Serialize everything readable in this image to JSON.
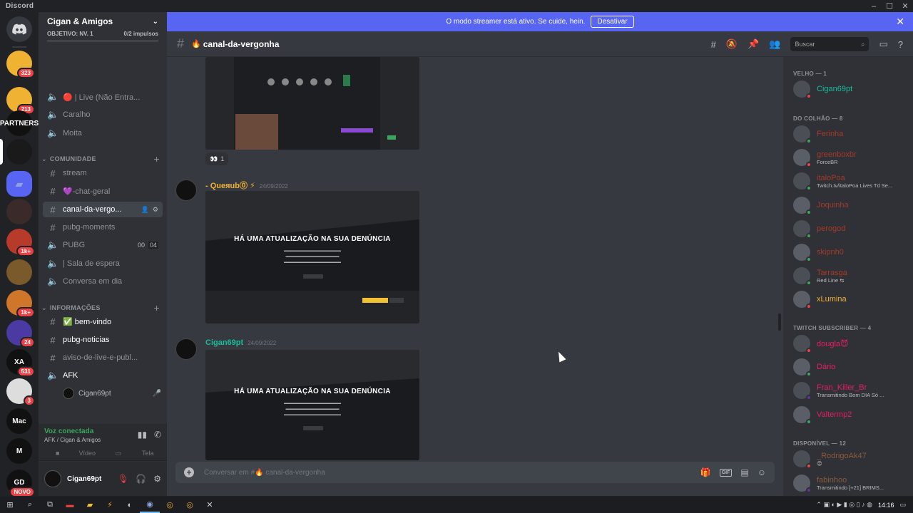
{
  "window": {
    "app_name": "Discord",
    "min": "–",
    "max": "☐",
    "close": "✕"
  },
  "rail": {
    "servers": [
      {
        "name": "server-1",
        "badge": "323",
        "color": "#f0b232",
        "label": ""
      },
      {
        "name": "server-2",
        "badge": "213",
        "color": "#f0b232",
        "label": ""
      },
      {
        "name": "server-partners",
        "badge": "",
        "color": "#111111",
        "label": "PARTNERS"
      },
      {
        "name": "server-cigan",
        "badge": "",
        "color": "#1a1a1a",
        "label": ""
      },
      {
        "name": "folder",
        "badge": "",
        "color": "#5865f2",
        "label": ""
      },
      {
        "name": "server-6",
        "badge": "",
        "color": "#3a2a2a",
        "label": ""
      },
      {
        "name": "server-7",
        "badge": "1k+",
        "color": "#b83a2a",
        "label": ""
      },
      {
        "name": "server-8",
        "badge": "",
        "color": "#7a5a2a",
        "label": ""
      },
      {
        "name": "server-9",
        "badge": "1k+",
        "color": "#d0762a",
        "label": ""
      },
      {
        "name": "server-10",
        "badge": "24",
        "color": "#4a3aa2",
        "label": ""
      },
      {
        "name": "server-xa",
        "badge": "531",
        "color": "#111111",
        "label": "XA"
      },
      {
        "name": "server-12",
        "badge": "3",
        "color": "#dddddd",
        "label": ""
      },
      {
        "name": "server-mac",
        "badge": "",
        "color": "#111111",
        "label": "Mac"
      },
      {
        "name": "server-m",
        "badge": "",
        "color": "#111111",
        "label": "M"
      },
      {
        "name": "server-gd",
        "badge": "NOVO",
        "color": "#111111",
        "label": "GD"
      }
    ]
  },
  "sidebar": {
    "server_name": "Cigan & Amigos",
    "boost": {
      "level": "OBJETIVO: NV. 1",
      "count": "0/2 impulsos"
    },
    "channels_top": [
      {
        "icon": "🔊",
        "label": "🔴 | Live (Não Entra...",
        "type": "voice"
      },
      {
        "icon": "🔊",
        "label": "Caralho",
        "type": "voice"
      },
      {
        "icon": "🔊",
        "label": "Moita",
        "type": "voice"
      }
    ],
    "cat_comunidade": "COMUNIDADE",
    "comunidade": [
      {
        "label": "stream"
      },
      {
        "label": "💜-chat-geral"
      },
      {
        "label": "canal-da-vergo..."
      },
      {
        "label": "pubg-moments"
      },
      {
        "label": "PUBG",
        "tail_a": "00",
        "tail_b": "04"
      },
      {
        "label": "| Sala de espera"
      },
      {
        "label": "Conversa em dia"
      }
    ],
    "cat_info": "INFORMAÇÕES",
    "info": [
      {
        "label": "✅ bem-vindo"
      },
      {
        "label": "pubg-noticias"
      },
      {
        "label": "aviso-de-live-e-publ..."
      },
      {
        "label": "AFK"
      }
    ],
    "voice_user": "Cigan69pt",
    "voice": {
      "status": "Voz conectada",
      "location": "AFK / Cigan & Amigos",
      "video": "Vídeo",
      "screen": "Tela"
    },
    "user": {
      "name": "Cigan69pt"
    }
  },
  "banner": {
    "text": "O modo streamer está ativo. Se cuide, hein.",
    "button": "Desativar"
  },
  "channel": {
    "name": "canal-da-vergonha",
    "search_placeholder": "Buscar"
  },
  "messages": [
    {
      "author": "- Queяub⓪ ⚡",
      "author_color": "#f0b232",
      "date": "24/09/2022",
      "dialog_title": "HÁ UMA ATUALIZAÇÃO NA SUA DENÚNCIA"
    },
    {
      "author": "Cigan69pt",
      "author_color": "#1abc9c",
      "date": "24/09/2022",
      "dialog_title": "HÁ UMA ATUALIZAÇÃO NA SUA DENÚNCIA"
    }
  ],
  "reaction": {
    "emoji": "👀",
    "count": "1"
  },
  "composer": {
    "placeholder": "Conversar em #🔥 canal-da-vergonha"
  },
  "members": {
    "velho_title": "VELHO — 1",
    "velho": [
      {
        "name": "Cigan69pt",
        "color": "#1abc9c",
        "status": "",
        "state": "#ed4245"
      }
    ],
    "colhao_title": "DO COLHÃO — 8",
    "colhao": [
      {
        "name": "Ferinha",
        "color": "#a33a2a",
        "status": "",
        "state": "#3ba55d"
      },
      {
        "name": "greenboxbr",
        "color": "#a33a2a",
        "status": "ForceBR",
        "state": "#ed4245"
      },
      {
        "name": "italoPoa",
        "color": "#a33a2a",
        "status": "Twitch.tv/italoPoa Lives Td Se...",
        "state": "#3ba55d"
      },
      {
        "name": "Joquinha",
        "color": "#a33a2a",
        "status": "",
        "state": "#3ba55d"
      },
      {
        "name": "perogod",
        "color": "#a33a2a",
        "status": "",
        "state": "#3ba55d"
      },
      {
        "name": "skipnh0",
        "color": "#a33a2a",
        "status": "",
        "state": "#3ba55d"
      },
      {
        "name": "Tarrasga",
        "color": "#a33a2a",
        "status": "Red Line ⇆",
        "state": "#3ba55d"
      },
      {
        "name": "xLumina",
        "color": "#f0b232",
        "status": "",
        "state": "#ed4245"
      }
    ],
    "twitch_title": "TWITCH SUBSCRIBER — 4",
    "twitch": [
      {
        "name": "dougla😈",
        "color": "#e91e63",
        "status": "",
        "state": "#ed4245"
      },
      {
        "name": "Dário",
        "color": "#e91e63",
        "status": "",
        "state": "#3ba55d"
      },
      {
        "name": "Fran_Killer_Br",
        "color": "#e91e63",
        "status": "Transmitindo Bom DIA Só ...",
        "state": "#593695"
      },
      {
        "name": "Valtermp2",
        "color": "#e91e63",
        "status": "",
        "state": "#3ba55d"
      }
    ],
    "disp_title": "DISPONÍVEL — 12",
    "disp": [
      {
        "name": "_RodrigoAk47",
        "color": "#8a5a3a",
        "status": "😡",
        "state": "#ed4245"
      },
      {
        "name": "fabinhoo",
        "color": "#8a5a3a",
        "status": "Transmitindo [+21] BRIMS...",
        "state": "#593695"
      }
    ]
  },
  "taskbar": {
    "clock": "14:16"
  }
}
